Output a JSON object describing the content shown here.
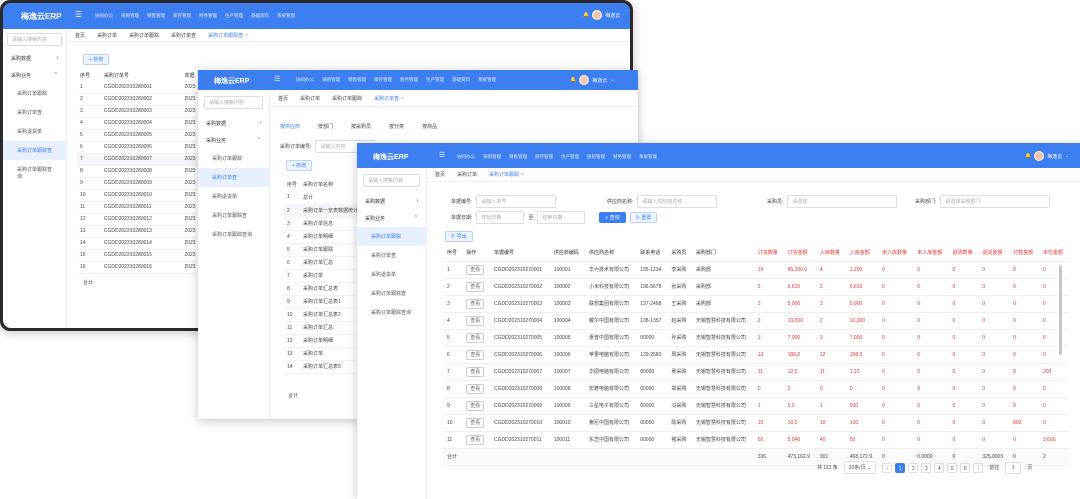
{
  "app": {
    "logo": "梅逸云ERP",
    "user": "梅逸云"
  },
  "back": {
    "tabs": [
      "首页",
      "采购订单",
      "采购订单跟踪",
      "采购订单查",
      "采购订单跟踪查"
    ],
    "add": "+ 新增",
    "side": {
      "search": "请输入搜索内容",
      "g1": "采购数据",
      "g2": "采购业务",
      "subs": [
        "采购订单跟踪",
        "采购订单查",
        "采购退货单",
        "采购订单跟踪查",
        "采购订单跟踪查询"
      ]
    },
    "cols": [
      "序号",
      "采购订单号",
      "单据"
    ],
    "rows": [
      [
        "1",
        "CGDD202310280001",
        "2023"
      ],
      [
        "2",
        "CGDD202310280002",
        "2023"
      ],
      [
        "3",
        "CGDD202310280003",
        "2023"
      ],
      [
        "4",
        "CGDD202310280004",
        "2023"
      ],
      [
        "5",
        "CGDD202310280005",
        "2023"
      ],
      [
        "6",
        "CGDD202310280006",
        "2023"
      ],
      [
        "7",
        "CGDD202310280007",
        "2023"
      ],
      [
        "8",
        "CGDD202310280008",
        "2023"
      ],
      [
        "9",
        "CGDD202310280009",
        "2023"
      ],
      [
        "10",
        "CGDD202310280010",
        "2023"
      ],
      [
        "11",
        "CGDD202310280011",
        "2023"
      ],
      [
        "12",
        "CGDD202310280012",
        "2023"
      ],
      [
        "13",
        "CGDD202310280013",
        "2023"
      ],
      [
        "14",
        "CGDD202310280014",
        "2023"
      ],
      [
        "15",
        "CGDD202310280015",
        "2023"
      ],
      [
        "16",
        "CGDD202310280016",
        "2023"
      ]
    ],
    "foot": "合计"
  },
  "mid": {
    "menu": [
      "协同办公",
      "采购管理",
      "销售管理",
      "库存管理",
      "财务管理",
      "生产管理",
      "基础资料",
      "系统管理"
    ],
    "search": "请输入搜索内容",
    "g1": "采购数据",
    "g2": "采购业务",
    "subs": [
      "采购订单跟踪",
      "采购订单查",
      "采购退货单",
      "采购订单跟踪查",
      "采购订单跟踪查询"
    ],
    "tabs": [
      "首页",
      "采购订单",
      "采购订单跟踪",
      "采购订单查"
    ],
    "subtabs": [
      "按供应商",
      "按部门",
      "按采购员",
      "按分类",
      "按商品"
    ],
    "filter_label": "采购订单编号:",
    "filter_ph": "请输入内容",
    "add": "+ 新增",
    "cols": [
      "序号",
      "采购订单名称"
    ],
    "rows": [
      [
        "1",
        "总计"
      ],
      [
        "2",
        "采购订单一览表数据统计"
      ],
      [
        "3",
        "采购订单信息"
      ],
      [
        "4",
        "采购订单明细"
      ],
      [
        "5",
        "采购订单跟踪"
      ],
      [
        "6",
        "采购订单汇总"
      ],
      [
        "7",
        "采购订单"
      ],
      [
        "8",
        "采购订单汇总表"
      ],
      [
        "9",
        "采购订单汇总表1"
      ],
      [
        "10",
        "采购订单汇总表2"
      ],
      [
        "11",
        "采购订单汇总"
      ],
      [
        "12",
        "采购订单明细"
      ],
      [
        "13",
        "采购订单"
      ],
      [
        "14",
        "采购订单汇总表3"
      ]
    ],
    "foot": "合计"
  },
  "front": {
    "menu": [
      "协同办公",
      "采购管理",
      "销售管理",
      "库存管理",
      "生产管理",
      "质检管理",
      "财务管理",
      "系统管理"
    ],
    "search": "请输入搜索内容",
    "g1": "采购数据",
    "g2": "采购业务",
    "subs": [
      "采购订单跟踪",
      "采购订单查",
      "采购退货单",
      "采购订单跟踪查",
      "采购订单跟踪查询"
    ],
    "tabs": [
      "首页",
      "采购订单",
      "采购订单跟踪"
    ],
    "f": {
      "l1": "单据编号:",
      "p1": "请输入单号",
      "l2": "供应商名称:",
      "p2": "请输入供应商名称",
      "l3": "采购员:",
      "p3": "请选择",
      "l4": "采购部门:",
      "p4": "请选择采购部门",
      "l5": "单据日期:",
      "p5": "开始日期",
      "to": "至",
      "p6": "结束日期",
      "search": "查询",
      "reset": "重置",
      "export": "导出"
    },
    "cols": [
      "序号",
      "操作",
      "单据编号",
      "供应商编码",
      "供应商名称",
      "联系电话",
      "采购员",
      "采购部门",
      "订货数量",
      "订货金额",
      "入库数量",
      "入库金额",
      "未入库数量",
      "未入库金额",
      "退货数量",
      "退货金额",
      "付款金额",
      "未付金额"
    ],
    "rows": [
      [
        "1",
        "查看",
        "CGDD202310270001",
        "100001",
        "华为技术有限公司",
        "135-1234",
        "李采购",
        "采购部",
        "14",
        "85,200.0",
        "4",
        "1,200",
        "0",
        "0",
        "0",
        "0",
        "0",
        "0"
      ],
      [
        "2",
        "查看",
        "CGDD202310270002",
        "100002",
        "小米科技有限公司",
        "136-5678",
        "张采购",
        "采购部",
        "2",
        "6,616",
        "2",
        "6,616",
        "0",
        "0",
        "0",
        "0",
        "0",
        "0"
      ],
      [
        "3",
        "查看",
        "CGDD202310270003",
        "100003",
        "联想集团有限公司",
        "137-2468",
        "王采购",
        "采购部",
        "3",
        "5,000",
        "3",
        "5,000",
        "0",
        "0",
        "0",
        "0",
        "0",
        "0"
      ],
      [
        "4",
        "查看",
        "CGDD202310270004",
        "100004",
        "戴尔中国有限公司",
        "138-1357",
        "赵采购",
        "无锡智慧科技有限公司",
        "2",
        "10,000",
        "2",
        "10,000",
        "0",
        "0",
        "0",
        "0",
        "0",
        "0"
      ],
      [
        "5",
        "查看",
        "CGDD202310270005",
        "100005",
        "惠普中国有限公司",
        "00000",
        "孙采购",
        "无锡智慧科技有限公司",
        "3",
        "7,000",
        "3",
        "7,000",
        "0",
        "0",
        "0",
        "0",
        "0",
        "0"
      ],
      [
        "6",
        "查看",
        "CGDD202310270006",
        "100006",
        "苹果电脑有限公司",
        "139-2580",
        "周采购",
        "无锡智慧科技有限公司",
        "13",
        "188,2",
        "12",
        "158.3",
        "0",
        "0",
        "0",
        "0",
        "0",
        "0"
      ],
      [
        "7",
        "查看",
        "CGDD202310270007",
        "100007",
        "华硕电脑有限公司",
        "00000",
        "吴采购",
        "无锡智慧科技有限公司",
        "11",
        "12,0",
        "11",
        "1,20",
        "0",
        "0",
        "0",
        "0",
        "0",
        "200"
      ],
      [
        "8",
        "查看",
        "CGDD202310270008",
        "100008",
        "宏碁电脑有限公司",
        "00000",
        "郑采购",
        "无锡智慧科技有限公司",
        "0",
        "0",
        "0",
        "0",
        "0",
        "0",
        "0",
        "0",
        "0",
        "0"
      ],
      [
        "9",
        "查看",
        "CGDD202310270009",
        "100009",
        "三星电子有限公司",
        "00000",
        "冯采购",
        "无锡智慧科技有限公司",
        "1",
        "5,0",
        "1",
        "500",
        "0",
        "0",
        "0",
        "0",
        "0",
        "0"
      ],
      [
        "10",
        "查看",
        "CGDD202310270010",
        "100010",
        "索尼中国有限公司",
        "00000",
        "陈采购",
        "无锡智慧科技有限公司",
        "10",
        "10,0",
        "10",
        "100",
        "0",
        "0",
        "0",
        "0",
        "800",
        "0"
      ],
      [
        "11",
        "查看",
        "CGDD202310270011",
        "100011",
        "东芝中国有限公司",
        "00000",
        "褚采购",
        "无锡智慧科技有限公司",
        "56",
        "5,040",
        "40",
        "50",
        "0",
        "0",
        "0",
        "0",
        "0",
        "3,600"
      ]
    ],
    "foot": [
      "合计",
      "336",
      "473,162.9",
      "301",
      "468,172.9",
      "0",
      "0.0000",
      "0",
      "325.0003",
      "0",
      "2"
    ],
    "pager": {
      "total": "共 113 条",
      "size": "20条/页",
      "pages": [
        "1",
        "2",
        "3",
        "4",
        "5",
        "6"
      ],
      "goto": "前往",
      "page": "1",
      "suffix": "页"
    }
  }
}
